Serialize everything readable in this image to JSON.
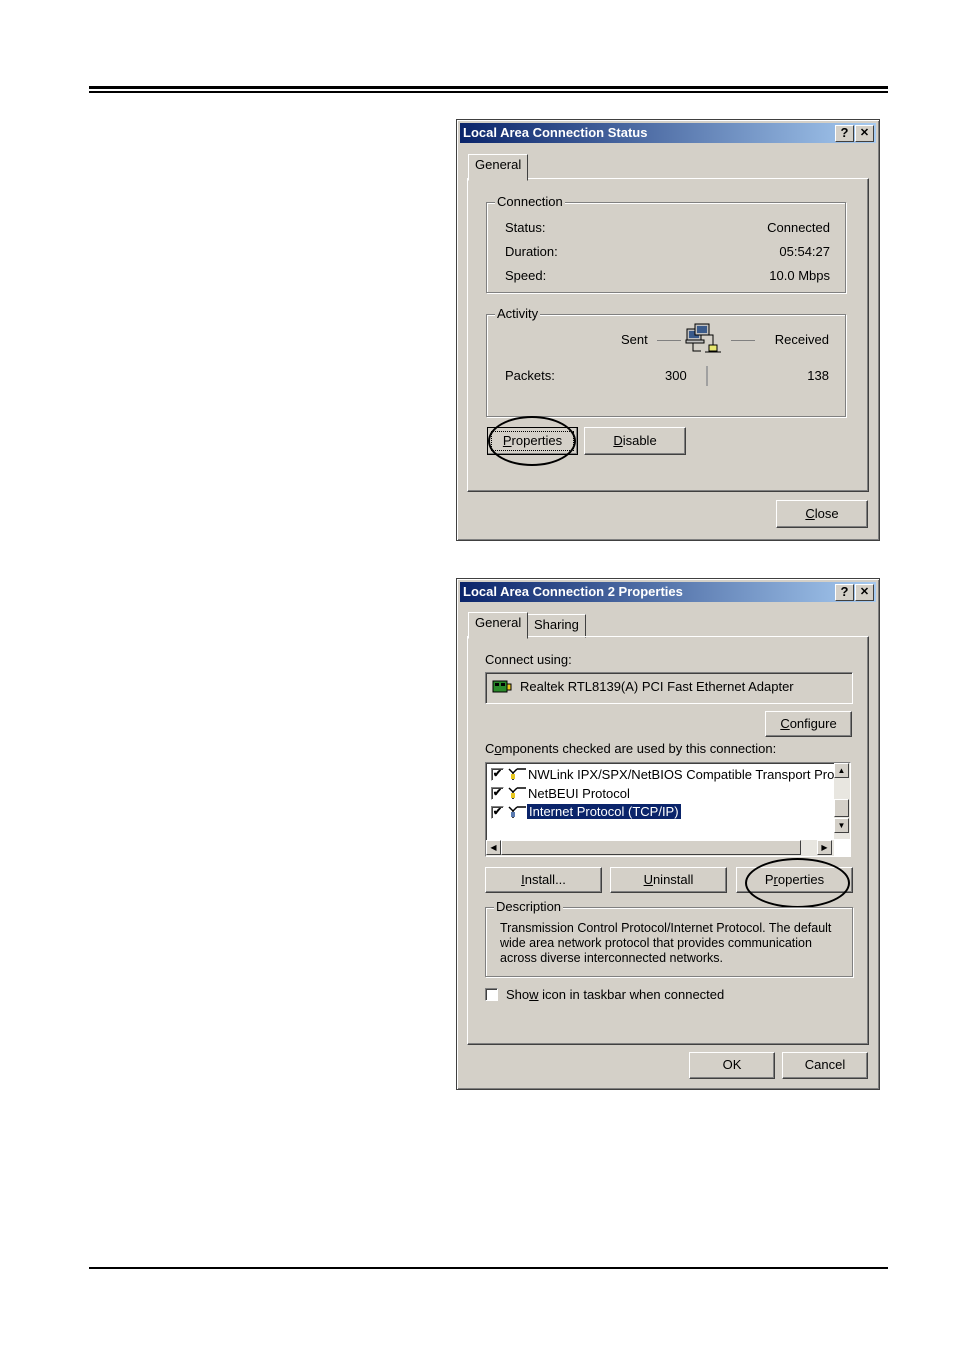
{
  "status_dialog": {
    "title": "Local Area Connection Status",
    "help_label": "?",
    "close_x_label": "✕",
    "tabs": [
      {
        "label": "General",
        "active": true
      }
    ],
    "connection_group": {
      "label": "Connection",
      "rows": [
        {
          "label": "Status:",
          "value": "Connected"
        },
        {
          "label": "Duration:",
          "value": "05:54:27"
        },
        {
          "label": "Speed:",
          "value": "10.0 Mbps"
        }
      ]
    },
    "activity_group": {
      "label": "Activity",
      "sent_label": "Sent",
      "received_label": "Received",
      "packets_label": "Packets:",
      "packets_sent": "300",
      "packets_received": "138",
      "icon": "network-computers-icon"
    },
    "buttons": {
      "properties": {
        "prefix": "",
        "accel": "P",
        "rest": "roperties",
        "circled": true
      },
      "disable": {
        "prefix": "",
        "accel": "D",
        "rest": "isable"
      },
      "close": {
        "prefix": "",
        "accel": "C",
        "rest": "lose"
      }
    }
  },
  "properties_dialog": {
    "title": "Local Area Connection 2 Properties",
    "help_label": "?",
    "close_x_label": "✕",
    "tabs": [
      {
        "label": "General",
        "active": true
      },
      {
        "label": "Sharing",
        "active": false
      }
    ],
    "connect_using_label": "Connect using:",
    "adapter": {
      "name": "Realtek RTL8139(A) PCI Fast Ethernet Adapter",
      "icon": "network-card-icon"
    },
    "configure": {
      "prefix": "",
      "accel": "C",
      "rest": "onfigure"
    },
    "components_label": {
      "prefix": "C",
      "accel": "o",
      "rest": "mponents checked are used by this connection:"
    },
    "components": [
      {
        "label": "NWLink IPX/SPX/NetBIOS Compatible Transport Proto",
        "checked": true,
        "selected": false,
        "icon": "protocol-icon"
      },
      {
        "label": "NetBEUI Protocol",
        "checked": true,
        "selected": false,
        "icon": "protocol-icon"
      },
      {
        "label": "Internet Protocol (TCP/IP)",
        "checked": true,
        "selected": true,
        "icon": "protocol-icon"
      }
    ],
    "check_mark": "✔",
    "buttons": {
      "install": {
        "prefix": "",
        "accel": "I",
        "rest": "nstall..."
      },
      "uninstall": {
        "prefix": "",
        "accel": "U",
        "rest": "ninstall"
      },
      "properties": {
        "prefix": "P",
        "accel": "r",
        "rest": "operties",
        "circled": true
      },
      "ok": "OK",
      "cancel": "Cancel"
    },
    "description": {
      "label": "Description",
      "text_lines": [
        "Transmission Control Protocol/Internet Protocol. The default",
        "wide area network protocol that provides communication",
        "across diverse interconnected networks."
      ]
    },
    "show_icon": {
      "prefix": "Sho",
      "accel": "w",
      "rest": " icon in taskbar when connected",
      "checked": false
    }
  },
  "colors": {
    "dialog_face": "#d4d0c8",
    "title_start": "#0a246a",
    "title_end": "#a6caf0",
    "selection": "#0a246a"
  }
}
